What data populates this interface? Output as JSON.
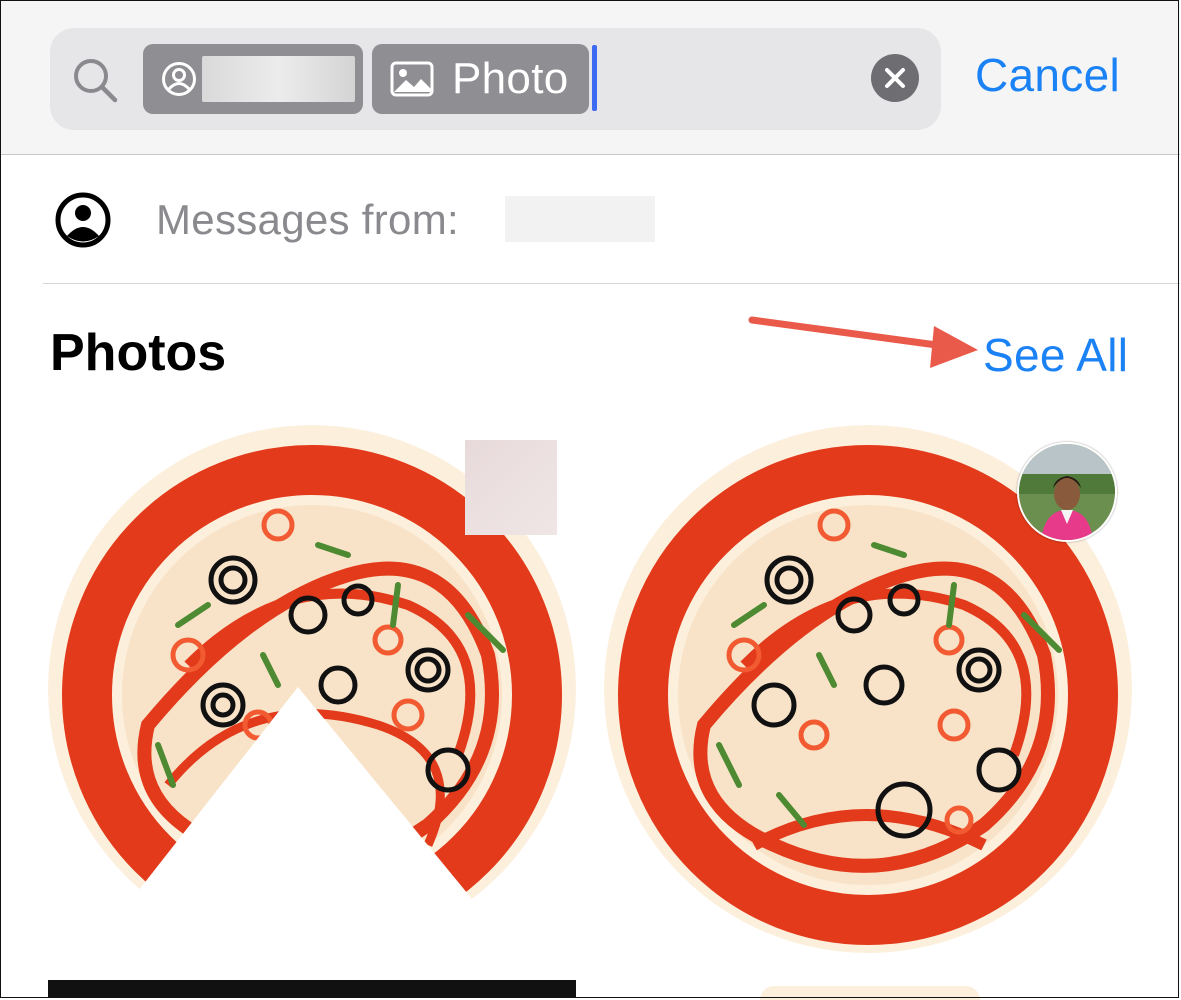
{
  "search": {
    "person_token_label": "",
    "photo_token_label": "Photo",
    "cancel_label": "Cancel"
  },
  "suggestion": {
    "label": "Messages from:"
  },
  "photos_section": {
    "title": "Photos",
    "see_all_label": "See All"
  },
  "colors": {
    "accent": "#1a82f5",
    "annotation_arrow": "#ea5a4a",
    "token_bg": "#8e8e93"
  },
  "icons": [
    "search-icon",
    "person-icon",
    "image-icon",
    "clear-icon",
    "person-circle-icon"
  ]
}
